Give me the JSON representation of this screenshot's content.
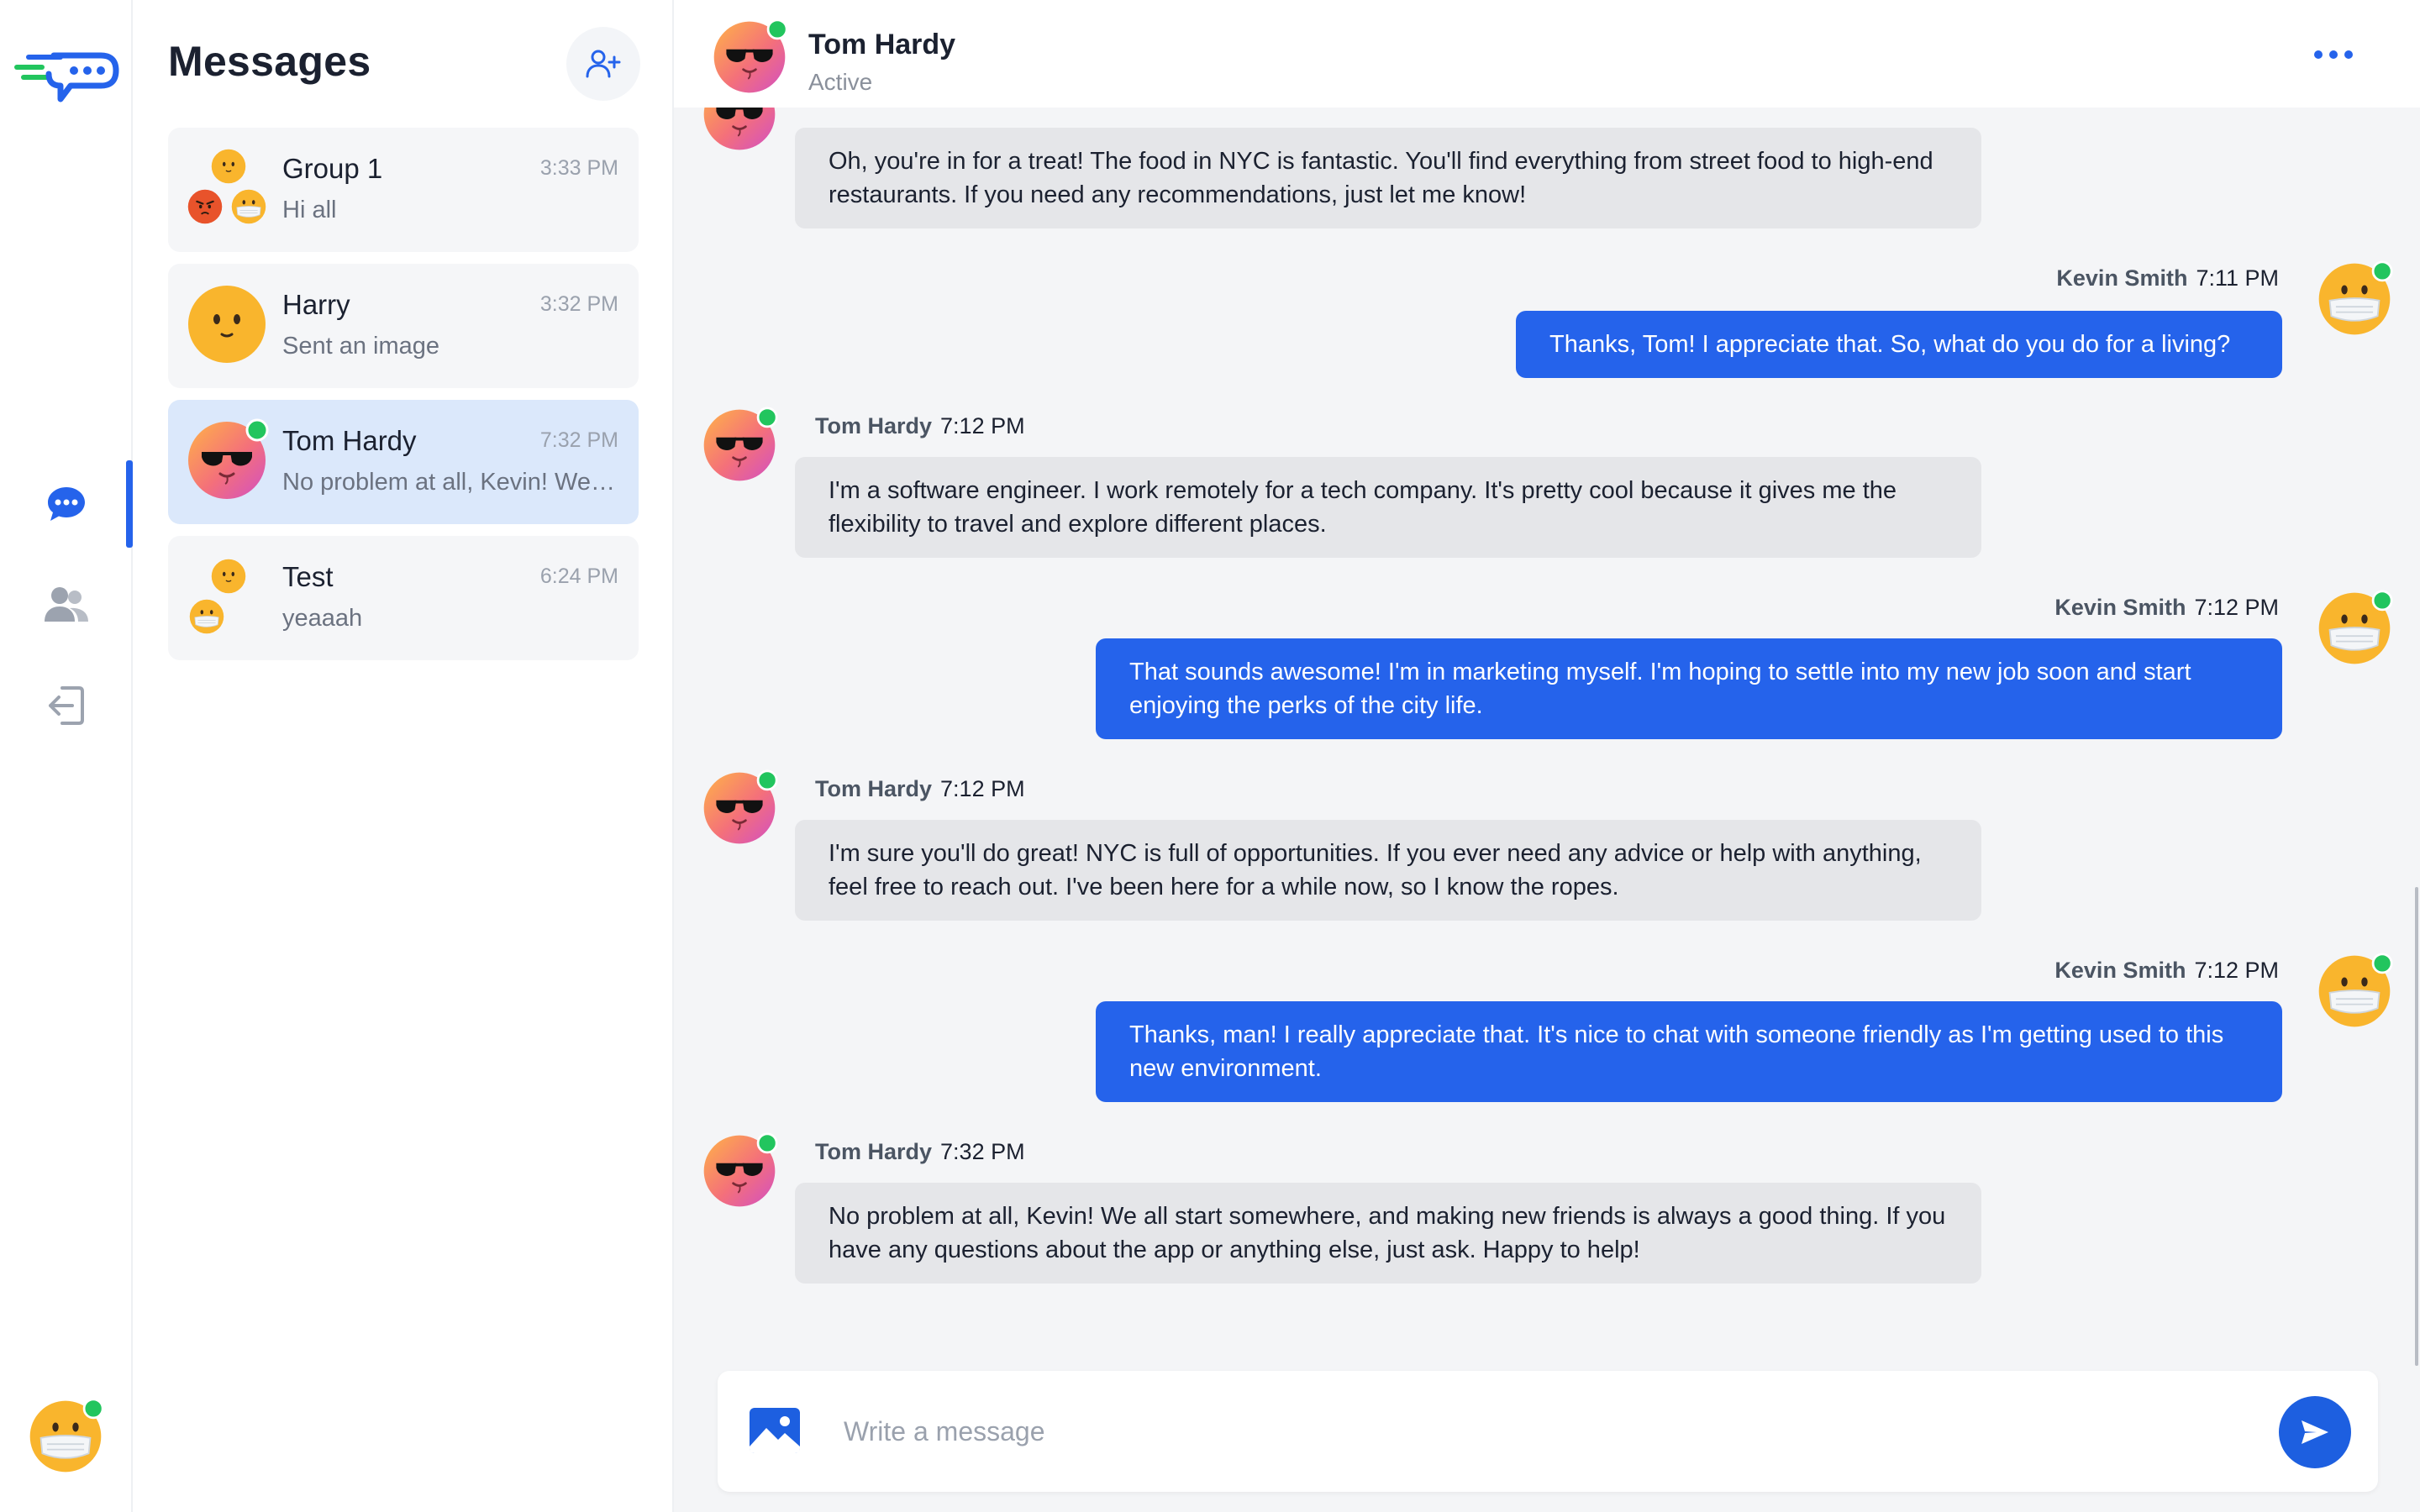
{
  "app": {
    "accent": "#2563eb",
    "online_color": "#22c55e"
  },
  "rail": {
    "logo_icon": "chat-logo-icon",
    "nav": [
      {
        "icon": "chat-bubble-icon",
        "active": true
      },
      {
        "icon": "users-icon",
        "active": false
      },
      {
        "icon": "logout-icon",
        "active": false
      }
    ],
    "current_user_avatar": "masked-face-emoji"
  },
  "list": {
    "title": "Messages",
    "add_icon": "add-user-icon",
    "conversations": [
      {
        "name": "Group 1",
        "time": "3:33 PM",
        "preview": "Hi all",
        "avatar": "group-emoji",
        "active": false
      },
      {
        "name": "Harry",
        "time": "3:32 PM",
        "preview": "Sent an image",
        "avatar": "smiling-face-emoji",
        "active": false
      },
      {
        "name": "Tom Hardy",
        "time": "7:32 PM",
        "preview": "No problem at all, Kevin! We all start somewhere, and making new friends is always a good thing.",
        "avatar": "sunglasses-face-emoji",
        "active": true,
        "online": true
      },
      {
        "name": "Test",
        "time": "6:24 PM",
        "preview": "yeaaah",
        "avatar": "group-emoji",
        "active": false
      }
    ]
  },
  "chat": {
    "header": {
      "name": "Tom Hardy",
      "status": "Active",
      "more_icon": "more-dots-icon"
    },
    "messages": [
      {
        "from": "Tom Hardy",
        "dir": "in",
        "time": "",
        "text": "Oh, you're in for a treat! The food in NYC is fantastic. You'll find everything from street food to high-end restaurants. If you need any recommendations, just let me know!"
      },
      {
        "from": "Kevin Smith",
        "dir": "out",
        "time": "7:11 PM",
        "text": "Thanks, Tom! I appreciate that. So, what do you do for a living?"
      },
      {
        "from": "Tom Hardy",
        "dir": "in",
        "time": "7:12 PM",
        "text": "I'm a software engineer. I work remotely for a tech company. It's pretty cool because it gives me the flexibility to travel and explore different places."
      },
      {
        "from": "Kevin Smith",
        "dir": "out",
        "time": "7:12 PM",
        "text": "That sounds awesome! I'm in marketing myself. I'm hoping to settle into my new job soon and start enjoying the perks of the city life."
      },
      {
        "from": "Tom Hardy",
        "dir": "in",
        "time": "7:12 PM",
        "text": "I'm sure you'll do great! NYC is full of opportunities. If you ever need any advice or help with anything, feel free to reach out. I've been here for a while now, so I know the ropes."
      },
      {
        "from": "Kevin Smith",
        "dir": "out",
        "time": "7:12 PM",
        "text": "Thanks, man! I really appreciate that. It's nice to chat with someone friendly as I'm getting used to this new environment."
      },
      {
        "from": "Tom Hardy",
        "dir": "in",
        "time": "7:32 PM",
        "text": "No problem at all, Kevin! We all start somewhere, and making new friends is always a good thing. If you have any questions about the app or anything else, just ask. Happy to help!"
      }
    ],
    "composer": {
      "placeholder": "Write a message",
      "value": "",
      "image_icon": "image-icon",
      "send_icon": "send-icon"
    }
  }
}
